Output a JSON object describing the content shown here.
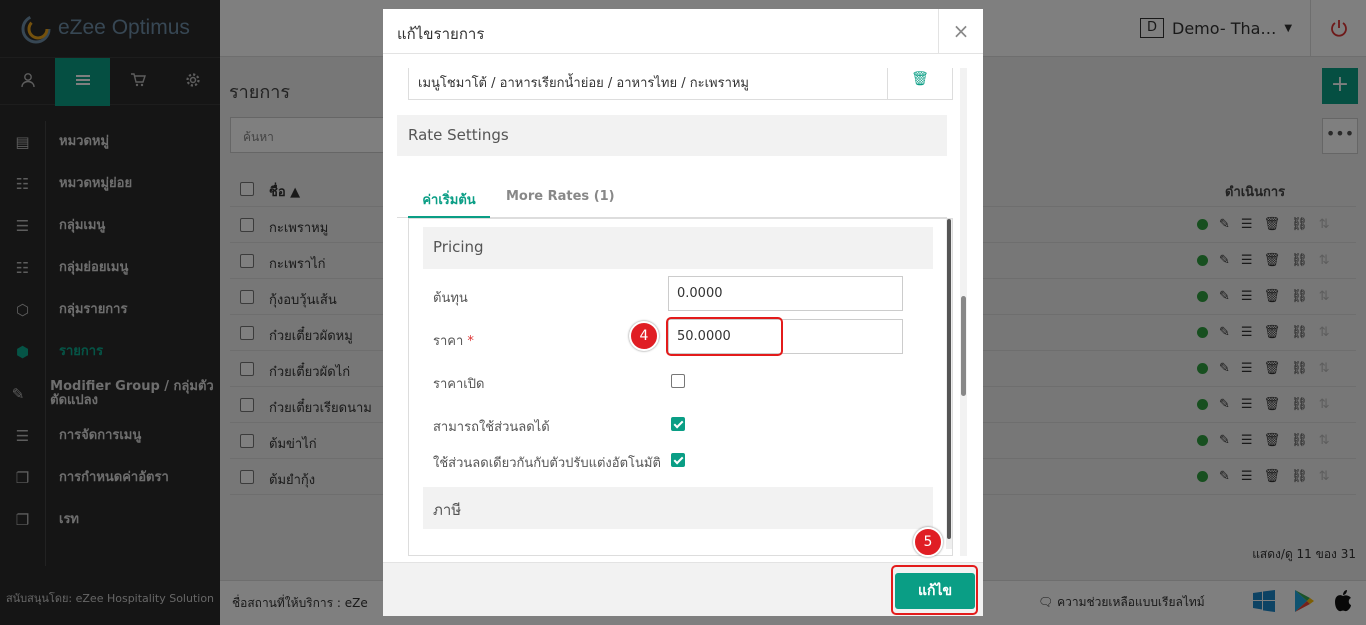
{
  "app": {
    "name": "eZee Optimus",
    "brand_color": "#0a9e85"
  },
  "sidebar": {
    "tabs": [
      {
        "icon": "user-icon"
      },
      {
        "icon": "list-icon"
      },
      {
        "icon": "cart-icon"
      },
      {
        "icon": "gear-icon"
      }
    ],
    "items": [
      {
        "label": "หมวดหมู่"
      },
      {
        "label": "หมวดหมู่ย่อย"
      },
      {
        "label": "กลุ่มเมนู"
      },
      {
        "label": "กลุ่มย่อยเมนู"
      },
      {
        "label": "กลุ่มรายการ"
      },
      {
        "label": "รายการ"
      },
      {
        "label": "Modifier Group / กลุ่มตัวตัดแปลง"
      },
      {
        "label": "การจัดการเมนู"
      },
      {
        "label": "การกำหนดค่าอัตรา"
      },
      {
        "label": "เรท"
      }
    ],
    "footer": "สนับสนุนโดย: eZee Hospitality Solution"
  },
  "topbar": {
    "user_badge": "D",
    "user_name": "Demo- Tha…"
  },
  "main": {
    "title": "รายการ",
    "search_placeholder": "ค้นหา",
    "col_name": "ชื่อ ▲",
    "col_actions": "ดำเนินการ",
    "rows": [
      "กะเพราหมู",
      "กะเพราไก่",
      "กุ้งอบวุ้นเส้น",
      "ก๋วยเตี๋ยวผัดหมู",
      "ก๋วยเตี๋ยวผัดไก่",
      "ก๋วยเตี๋ยวเรียดนาม",
      "ต้มข่าไก่",
      "ต้มยำกุ้ง"
    ],
    "pager": "แสดง/ดู 11 ของ 31"
  },
  "bottombar": {
    "provider": "ชื่อสถานที่ให้บริการ : eZe",
    "support": "ความช่วยเหลือแบบเรียลไทม์"
  },
  "modal": {
    "title": "แก้ไขรายการ",
    "close": "×",
    "category_path": "เมนูโชมาโต้ / อาหารเรียกน้ำย่อย / อาหารไทย / กะเพราหมู",
    "rate_settings": "Rate Settings",
    "tab_base": "ค่าเริ่มต้น",
    "tab_more": "More Rates (1)",
    "pricing": "Pricing",
    "cost_label": "ต้นทุน",
    "cost_value": "0.0000",
    "price_label": "ราคา",
    "price_required": "*",
    "price_value": "50.0000",
    "open_price_label": "ราคาเปิด",
    "open_price_checked": false,
    "discount_label": "สามารถใช้ส่วนลดได้",
    "discount_checked": true,
    "auto_discount_label": "ใช้ส่วนลดเดียวกันกับตัวปรับแต่งอัตโนมัติ",
    "auto_discount_checked": true,
    "tax": "ภาษี",
    "save": "แก้ไข"
  },
  "annotations": {
    "mark_price": "4",
    "mark_save": "5",
    "highlight_color": "#e31b1b"
  }
}
